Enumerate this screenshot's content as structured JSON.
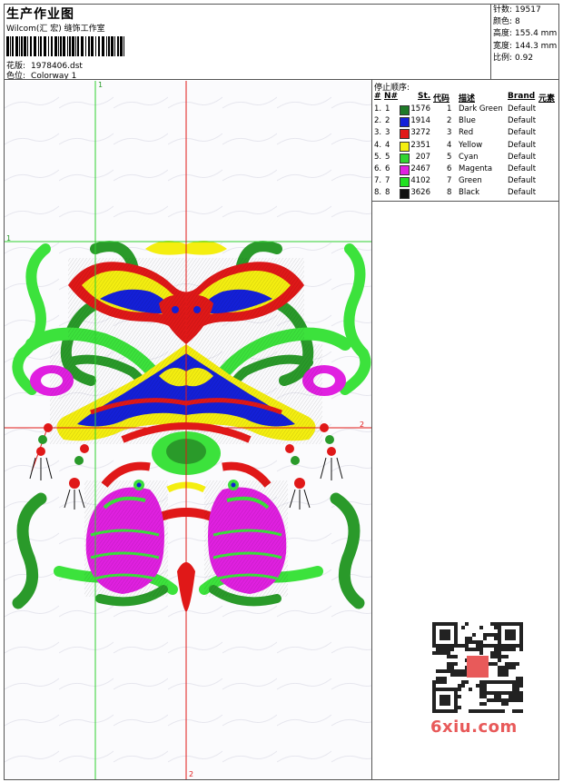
{
  "header": {
    "title": "生产作业图",
    "subtitle": "Wilcom(汇 宏) 缝饰工作室",
    "design_label": "花版:",
    "design_value": "1978406.dst",
    "colorway_label": "色位:",
    "colorway_value": "Colorway 1"
  },
  "stats": [
    {
      "label": "针数:",
      "value": "19517"
    },
    {
      "label": "颜色:",
      "value": "8"
    },
    {
      "label": "高度:",
      "value": "155.4 mm"
    },
    {
      "label": "宽度:",
      "value": "144.3 mm"
    },
    {
      "label": "比例:",
      "value": "0.92"
    }
  ],
  "guides": {
    "v1_label": "1",
    "h1_label": "1",
    "h2_label": "2",
    "v2_label": "2"
  },
  "stop_sequence": {
    "title": "停止顺序:",
    "columns": [
      "#",
      "N#",
      "St.",
      "代码",
      "描述",
      "Brand",
      "元素"
    ],
    "rows": [
      {
        "num": "1.",
        "n": "1",
        "color": "#1e7a28",
        "stitches": "1576",
        "code": "1",
        "desc": "Dark Green",
        "brand": "Default"
      },
      {
        "num": "2.",
        "n": "2",
        "color": "#1420d8",
        "stitches": "1914",
        "code": "2",
        "desc": "Blue",
        "brand": "Default"
      },
      {
        "num": "3.",
        "n": "3",
        "color": "#e01818",
        "stitches": "3272",
        "code": "3",
        "desc": "Red",
        "brand": "Default"
      },
      {
        "num": "4.",
        "n": "4",
        "color": "#f4ee10",
        "stitches": "2351",
        "code": "4",
        "desc": "Yellow",
        "brand": "Default"
      },
      {
        "num": "5.",
        "n": "5",
        "color": "#30d430",
        "stitches": "207",
        "code": "5",
        "desc": "Cyan",
        "brand": "Default"
      },
      {
        "num": "6.",
        "n": "6",
        "color": "#e020e0",
        "stitches": "2467",
        "code": "6",
        "desc": "Magenta",
        "brand": "Default"
      },
      {
        "num": "7.",
        "n": "7",
        "color": "#20e020",
        "stitches": "4102",
        "code": "7",
        "desc": "Green",
        "brand": "Default"
      },
      {
        "num": "8.",
        "n": "8",
        "color": "#111111",
        "stitches": "3626",
        "code": "8",
        "desc": "Black",
        "brand": "Default"
      }
    ]
  },
  "watermark": {
    "logo_text": "6xiu.com",
    "logo_color": "#e85a5a"
  }
}
